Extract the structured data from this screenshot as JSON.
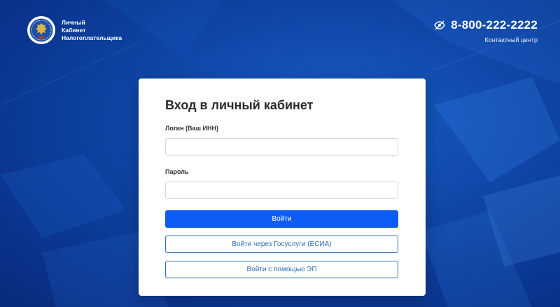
{
  "header": {
    "brand_line1": "Личный",
    "brand_line2": "Кабинет",
    "brand_line3": "Налогоплательщика",
    "phone": "8-800-222-2222",
    "contact_label": "Контактный центр"
  },
  "login_form": {
    "title": "Вход в личный кабинет",
    "login_label": "Логин (Ваш ИНН)",
    "login_value": "",
    "password_label": "Пароль",
    "password_value": "",
    "submit_label": "Войти",
    "gosuslugi_label": "Войти через Госуслуги (ЕСИА)",
    "ep_label": "Войти с помощью ЭП"
  },
  "icons": {
    "brand": "fns-emblem-icon",
    "contact": "hidden-eye-icon"
  },
  "colors": {
    "background": "#0f47a8",
    "primary_button": "#0d5cf5",
    "outline_button": "#2d6fb5",
    "card": "#ffffff"
  }
}
